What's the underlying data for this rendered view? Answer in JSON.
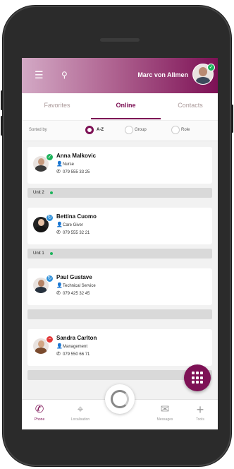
{
  "header": {
    "user_name": "Marc von Allmen",
    "menu_icon": "menu-icon",
    "search_icon": "search-icon"
  },
  "tabs": [
    {
      "label": "Favorites",
      "active": false
    },
    {
      "label": "Online",
      "active": true
    },
    {
      "label": "Contacts",
      "active": false
    }
  ],
  "sort": {
    "label": "Sorted by",
    "options": [
      {
        "label": "A-Z",
        "selected": true
      },
      {
        "label": "Group",
        "selected": false
      },
      {
        "label": "Role",
        "selected": false
      }
    ]
  },
  "contacts": [
    {
      "name": "Anna Malkovic",
      "role": "Nurse",
      "phone": "079 555 33 25",
      "status": "online",
      "unit": "Unit 2"
    },
    {
      "name": "Bettina Cuomo",
      "role": "Care Giver",
      "phone": "079 555 32 21",
      "status": "busy",
      "unit": "Unit 1"
    },
    {
      "name": "Paul Gustave",
      "role": "Technical Service",
      "phone": "079 425 32 45",
      "status": "busy",
      "unit": ""
    },
    {
      "name": "Sandra Carlton",
      "role": "Management",
      "phone": "079 550 66 71",
      "status": "dnd",
      "unit": ""
    }
  ],
  "bottom_nav": [
    {
      "label": "Phone",
      "icon": "phone-icon",
      "active": true
    },
    {
      "label": "Localisation",
      "icon": "location-pin-icon",
      "active": false
    },
    {
      "label": "Messages",
      "icon": "message-icon",
      "active": false
    },
    {
      "label": "Tools",
      "icon": "plus-icon",
      "active": false
    }
  ],
  "colors": {
    "brand": "#7d1155",
    "online": "#1db35c",
    "busy": "#2d8fd8",
    "dnd": "#e23a3a"
  }
}
